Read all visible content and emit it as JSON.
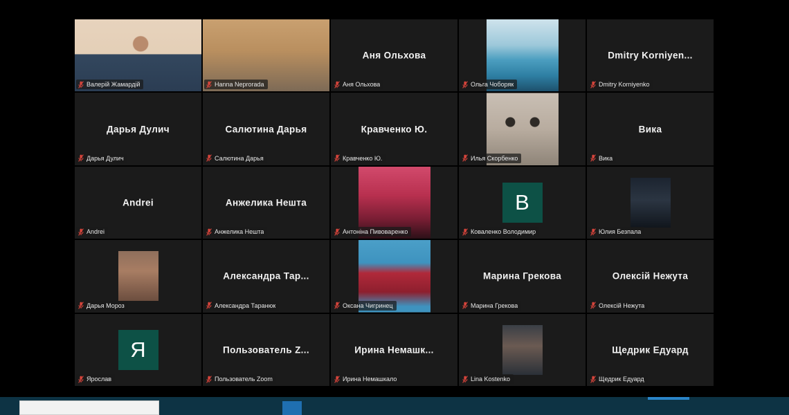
{
  "app": {
    "name": "Zoom",
    "view": "gallery-view"
  },
  "theme": {
    "background": "#000000",
    "tile_background": "#1b1b1b",
    "active_speaker_border": "#c8e05a",
    "avatar_background": "#0d5146",
    "name_text": "#e8e8e8",
    "center_name_text": "#f2f2f2",
    "mic_muted_icon": "#d9453c",
    "taskbar_background": "#0d3344"
  },
  "icons": {
    "mic_muted": "microphone-muted-icon"
  },
  "grid": {
    "columns": 5,
    "rows": 5,
    "participant_count": 25
  },
  "participants": [
    {
      "id": 1,
      "name_label": "Валерій Жамардій",
      "center_name": "",
      "tile_type": "video",
      "speaking": true,
      "muted": true,
      "photo": "ph-valerii",
      "media_class": "full"
    },
    {
      "id": 2,
      "name_label": "Hanna Neprorada",
      "center_name": "",
      "tile_type": "video",
      "speaking": false,
      "muted": true,
      "photo": "ph-hanna",
      "media_class": "full"
    },
    {
      "id": 3,
      "name_label": "Аня Ольхова",
      "center_name": "Аня Ольхова",
      "tile_type": "name",
      "speaking": false,
      "muted": true,
      "photo": "",
      "media_class": ""
    },
    {
      "id": 4,
      "name_label": "Ольга Чоборяк",
      "center_name": "",
      "tile_type": "photo",
      "speaking": false,
      "muted": true,
      "photo": "ph-olha",
      "media_class": "tall"
    },
    {
      "id": 5,
      "name_label": "Dmitry Korniyenko",
      "center_name": "Dmitry  Korniyen...",
      "tile_type": "name",
      "speaking": false,
      "muted": true,
      "photo": "",
      "media_class": ""
    },
    {
      "id": 6,
      "name_label": "Дарья Дулич",
      "center_name": "Дарья Дулич",
      "tile_type": "name",
      "speaking": false,
      "muted": true,
      "photo": "",
      "media_class": ""
    },
    {
      "id": 7,
      "name_label": "Салютина Дарья",
      "center_name": "Салютина Дарья",
      "tile_type": "name",
      "speaking": false,
      "muted": true,
      "photo": "",
      "media_class": ""
    },
    {
      "id": 8,
      "name_label": "Кравченко Ю.",
      "center_name": "Кравченко Ю.",
      "tile_type": "name",
      "speaking": false,
      "muted": true,
      "photo": "",
      "media_class": ""
    },
    {
      "id": 9,
      "name_label": "Илья Скорбенко",
      "center_name": "",
      "tile_type": "photo",
      "speaking": false,
      "muted": true,
      "photo": "ph-cat",
      "media_class": "tall"
    },
    {
      "id": 10,
      "name_label": "Вика",
      "center_name": "Вика",
      "tile_type": "name",
      "speaking": false,
      "muted": true,
      "photo": "",
      "media_class": ""
    },
    {
      "id": 11,
      "name_label": "Andrei",
      "center_name": "Andrei",
      "tile_type": "name",
      "speaking": false,
      "muted": true,
      "photo": "",
      "media_class": ""
    },
    {
      "id": 12,
      "name_label": "Анжелика Нешта",
      "center_name": "Анжелика Нешта",
      "tile_type": "name",
      "speaking": false,
      "muted": true,
      "photo": "",
      "media_class": ""
    },
    {
      "id": 13,
      "name_label": "Антоніна Пивоваренко",
      "center_name": "",
      "tile_type": "photo",
      "speaking": false,
      "muted": true,
      "photo": "ph-antonina",
      "media_class": "tall"
    },
    {
      "id": 14,
      "name_label": "Коваленко Володимир",
      "center_name": "",
      "tile_type": "avatar",
      "speaking": false,
      "muted": true,
      "avatar_letter": "В"
    },
    {
      "id": 15,
      "name_label": "Юлия Безпала",
      "center_name": "",
      "tile_type": "photo",
      "speaking": false,
      "muted": true,
      "photo": "ph-yuliia",
      "media_class": "portrait"
    },
    {
      "id": 16,
      "name_label": "Дарья Мороз",
      "center_name": "",
      "tile_type": "photo",
      "speaking": false,
      "muted": true,
      "photo": "ph-daria-moroz",
      "media_class": "portrait"
    },
    {
      "id": 17,
      "name_label": "Александра Таранюк",
      "center_name": "Александра  Тар...",
      "tile_type": "name",
      "speaking": false,
      "muted": true,
      "photo": "",
      "media_class": ""
    },
    {
      "id": 18,
      "name_label": "Оксана Чигринец",
      "center_name": "",
      "tile_type": "photo",
      "speaking": false,
      "muted": true,
      "photo": "ph-oksana",
      "media_class": "tall"
    },
    {
      "id": 19,
      "name_label": "Марина Грекова",
      "center_name": "Марина Грекова",
      "tile_type": "name",
      "speaking": false,
      "muted": true,
      "photo": "",
      "media_class": ""
    },
    {
      "id": 20,
      "name_label": "Олексій Нежута",
      "center_name": "Олексій Нежута",
      "tile_type": "name",
      "speaking": false,
      "muted": true,
      "photo": "",
      "media_class": ""
    },
    {
      "id": 21,
      "name_label": "Ярослав",
      "center_name": "",
      "tile_type": "avatar",
      "speaking": false,
      "muted": true,
      "avatar_letter": "Я"
    },
    {
      "id": 22,
      "name_label": "Пользователь Zoom",
      "center_name": "Пользователь  Z...",
      "tile_type": "name",
      "speaking": false,
      "muted": true,
      "photo": "",
      "media_class": ""
    },
    {
      "id": 23,
      "name_label": "Ирина Немашкало",
      "center_name": "Ирина  Немашк...",
      "tile_type": "name",
      "speaking": false,
      "muted": true,
      "photo": "",
      "media_class": ""
    },
    {
      "id": 24,
      "name_label": "Lina Kostenko",
      "center_name": "",
      "tile_type": "photo",
      "speaking": false,
      "muted": true,
      "photo": "ph-lina",
      "media_class": "portrait"
    },
    {
      "id": 25,
      "name_label": "Щедрик Едуард",
      "center_name": "Щедрик Едуард",
      "tile_type": "name",
      "speaking": false,
      "muted": true,
      "photo": "",
      "media_class": ""
    }
  ],
  "taskbar": {
    "visible": true
  }
}
